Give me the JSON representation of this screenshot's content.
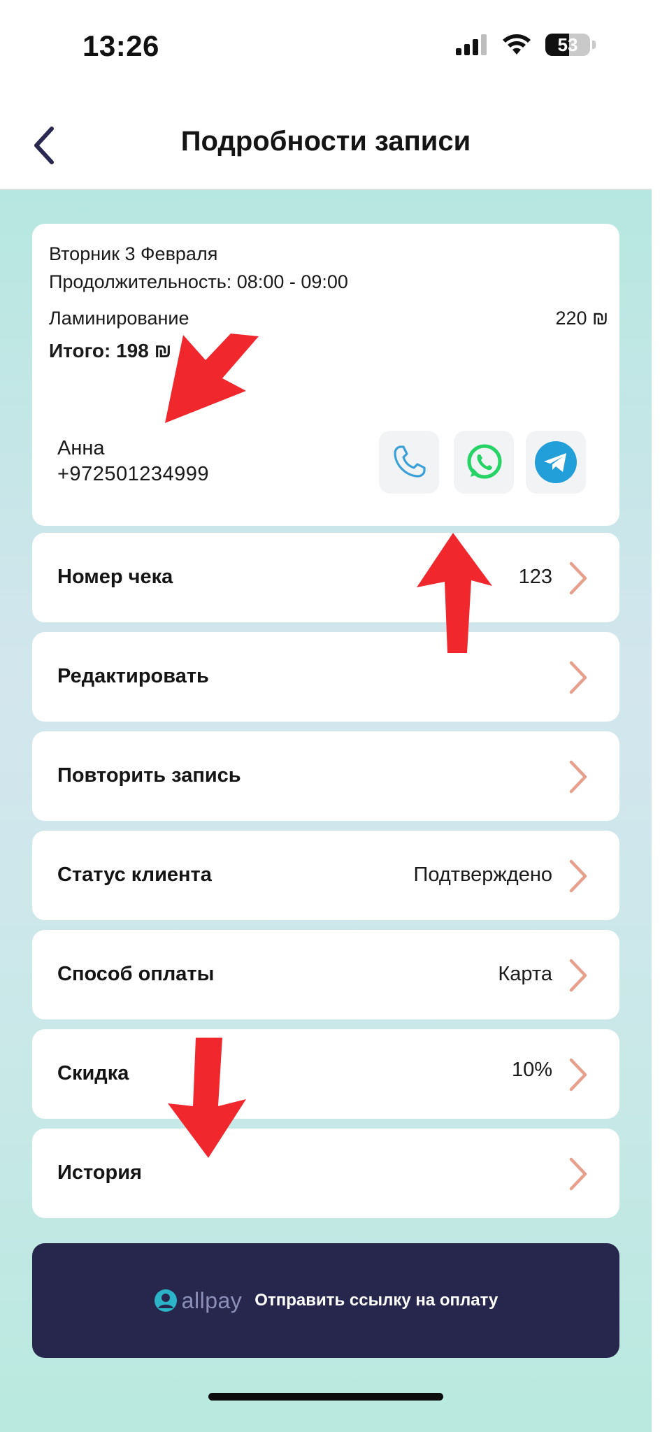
{
  "status_bar": {
    "time": "13:26",
    "battery": "53",
    "battery_level": 0.53
  },
  "header": {
    "title": "Подробности записи"
  },
  "appointment": {
    "date": "Вторник 3 Февраля",
    "duration": "Продолжительность: 08:00 - 09:00",
    "service": "Ламинирование",
    "service_price": "220 ₪",
    "total": "Итого: 198 ₪"
  },
  "client": {
    "name": "Анна",
    "phone": "+972501234999"
  },
  "contact_icons": [
    "phone-icon",
    "whatsapp-icon",
    "telegram-icon"
  ],
  "rows": [
    {
      "label": "Номер чека",
      "value": "123"
    },
    {
      "label": "Редактировать",
      "value": ""
    },
    {
      "label": "Повторить запись",
      "value": ""
    },
    {
      "label": "Статус клиента",
      "value": "Подтверждено"
    },
    {
      "label": "Способ оплаты",
      "value": "Карта"
    },
    {
      "label": "Скидка",
      "value": "10%"
    },
    {
      "label": "История",
      "value": ""
    }
  ],
  "payment_button": {
    "brand": "allpay",
    "label": "Отправить ссылку на оплату"
  },
  "colors": {
    "accent_chevron": "#e8a08c",
    "pay_button_bg": "#27274d",
    "annotation_arrow": "#f0282e",
    "whatsapp": "#25d366",
    "telegram": "#229ed9",
    "phone": "#3aa0d8"
  }
}
